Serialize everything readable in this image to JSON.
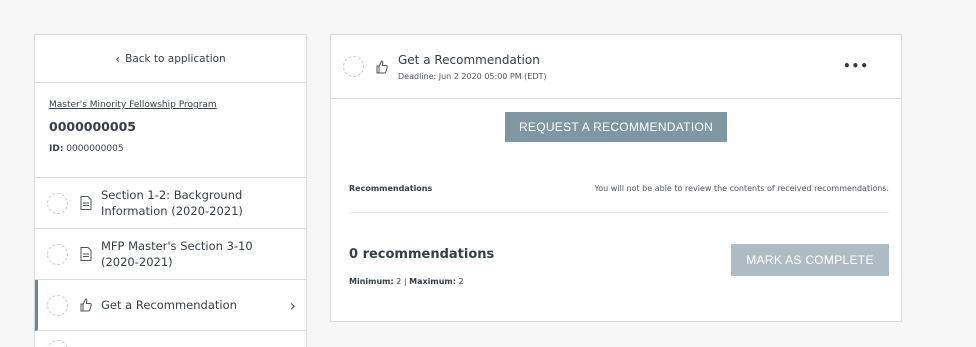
{
  "sidebar": {
    "back_label": "Back to application",
    "program": {
      "link": "Master's Minority Fellowship Program",
      "code": "0000000005",
      "id_label": "ID:",
      "id_value": "0000000005"
    },
    "sections": [
      {
        "label": "Section 1-2: Background Information (2020-2021)",
        "icon": "document-icon"
      },
      {
        "label": "MFP Master's Section 3-10 (2020-2021)",
        "icon": "document-icon"
      },
      {
        "label": "Get a Recommendation",
        "icon": "thumbs-up-icon"
      }
    ]
  },
  "main": {
    "title": "Get a Recommendation",
    "deadline": "Deadline: Jun 2 2020 05:00 PM (EDT)",
    "more_label": "•••",
    "request_button": "REQUEST A RECOMMENDATION",
    "recommendations_label": "Recommendations",
    "recommendations_note": "You will not be able to review the contents of received recommendations.",
    "count_title": "0 recommendations",
    "minimum_label": "Minimum:",
    "minimum_value": "2",
    "maximum_label": "Maximum:",
    "maximum_value": "2",
    "complete_button": "MARK AS COMPLETE"
  },
  "colors": {
    "background": "#f7f7f7",
    "primary_button": "#7f97a3",
    "disabled_button": "#aebcc4",
    "active_indicator": "#6b8896"
  }
}
